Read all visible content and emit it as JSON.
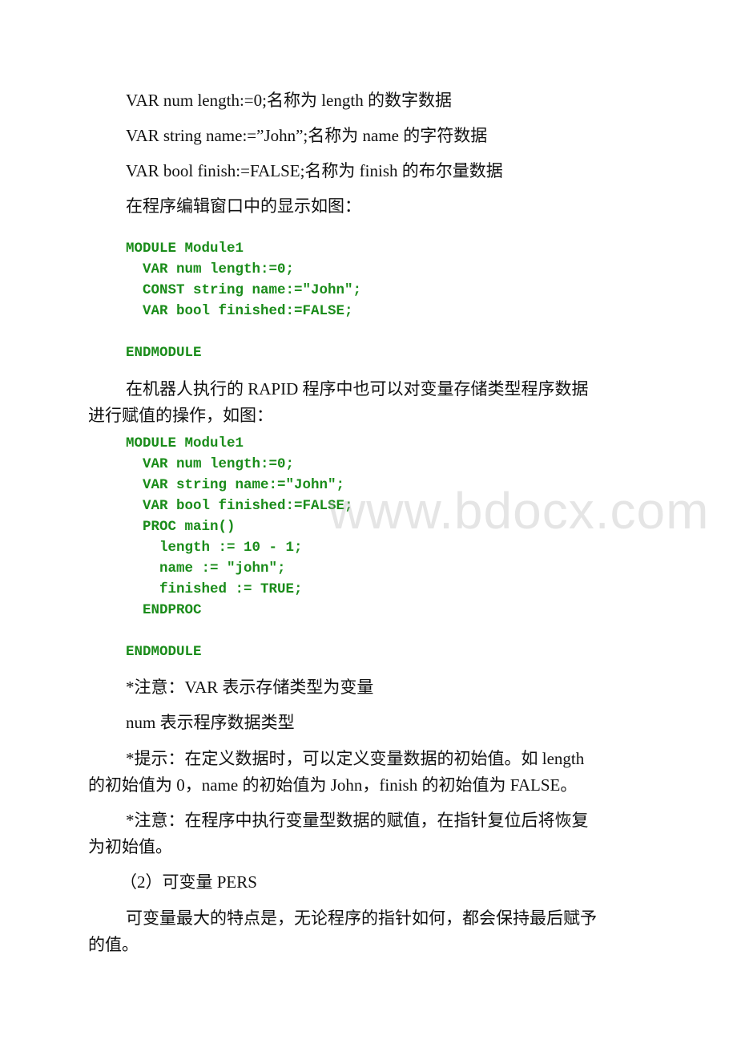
{
  "paragraphs": {
    "p1": "VAR num length:=0;名称为 length 的数字数据",
    "p2": "VAR string name:=”John”;名称为 name 的字符数据",
    "p3": "VAR bool finish:=FALSE;名称为 finish 的布尔量数据",
    "p4": "在程序编辑窗口中的显示如图：",
    "p5_line1": "在机器人执行的 RAPID 程序中也可以对变量存储类型程序数据",
    "p5_line2": "进行赋值的操作，如图：",
    "note1": "*注意：VAR 表示存储类型为变量",
    "note2": "num 表示程序数据类型",
    "tip_line1": "*提示：在定义数据时，可以定义变量数据的初始值。如 length",
    "tip_line2": "的初始值为 0，name 的初始值为 John，finish 的初始值为 FALSE。",
    "note3_line1": "*注意：在程序中执行变量型数据的赋值，在指针复位后将恢复",
    "note3_line2": "为初始值。",
    "heading2": "（2）可变量 PERS",
    "pers_line1": "可变量最大的特点是，无论程序的指针如何，都会保持最后赋予",
    "pers_line2": "的值。"
  },
  "code_block_1": [
    "MODULE Module1",
    "  VAR num length:=0;",
    "  CONST string name:=\"John\";",
    "  VAR bool finished:=FALSE;",
    "",
    "ENDMODULE"
  ],
  "code_block_2": [
    "MODULE Module1",
    "  VAR num length:=0;",
    "  VAR string name:=\"John\";",
    "  VAR bool finished:=FALSE;",
    "  PROC main()",
    "    length := 10 - 1;",
    "    name := \"john\";",
    "    finished := TRUE;",
    "  ENDPROC",
    "",
    "ENDMODULE"
  ],
  "watermark": "www.bdocx.com",
  "colors": {
    "code_green": "#1a8c1a",
    "text": "#111111"
  }
}
